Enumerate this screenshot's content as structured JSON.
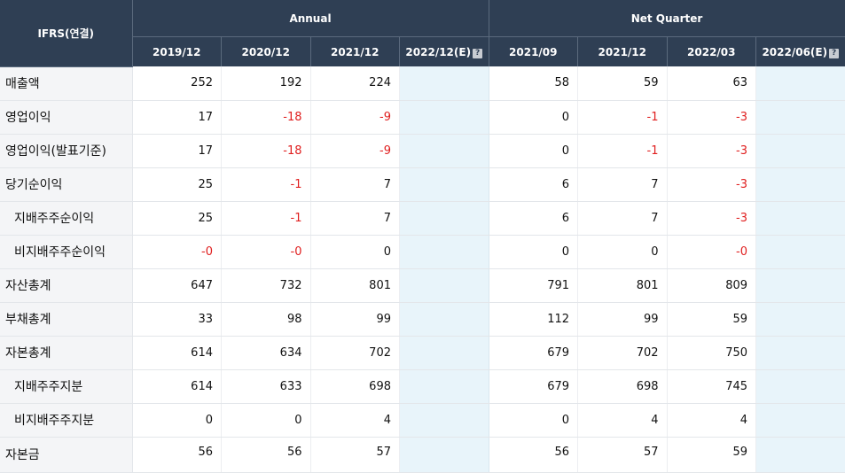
{
  "header": {
    "corner": "IFRS(연결)",
    "groups": [
      "Annual",
      "Net Quarter"
    ],
    "periods": [
      "2019/12",
      "2020/12",
      "2021/12",
      "2022/12(E)",
      "2021/09",
      "2021/12",
      "2022/03",
      "2022/06(E)"
    ],
    "help_icon": "question-mark-icon",
    "help_glyph": "?"
  },
  "colors": {
    "header_bg": "#2f3f54",
    "negative": "#e02020",
    "estimate_bg": "#e8f4fa"
  },
  "rows": [
    {
      "label": "매출액",
      "values": [
        "252",
        "192",
        "224",
        "",
        "58",
        "59",
        "63",
        ""
      ]
    },
    {
      "label": "영업이익",
      "values": [
        "17",
        "-18",
        "-9",
        "",
        "0",
        "-1",
        "-3",
        ""
      ]
    },
    {
      "label": "영업이익(발표기준)",
      "values": [
        "17",
        "-18",
        "-9",
        "",
        "0",
        "-1",
        "-3",
        ""
      ]
    },
    {
      "label": "당기순이익",
      "values": [
        "25",
        "-1",
        "7",
        "",
        "6",
        "7",
        "-3",
        ""
      ]
    },
    {
      "label": "지배주주순이익",
      "values": [
        "25",
        "-1",
        "7",
        "",
        "6",
        "7",
        "-3",
        ""
      ]
    },
    {
      "label": "비지배주주순이익",
      "values": [
        "-0",
        "-0",
        "0",
        "",
        "0",
        "0",
        "-0",
        ""
      ]
    },
    {
      "label": "자산총계",
      "values": [
        "647",
        "732",
        "801",
        "",
        "791",
        "801",
        "809",
        ""
      ]
    },
    {
      "label": "부채총계",
      "values": [
        "33",
        "98",
        "99",
        "",
        "112",
        "99",
        "59",
        ""
      ]
    },
    {
      "label": "자본총계",
      "values": [
        "614",
        "634",
        "702",
        "",
        "679",
        "702",
        "750",
        ""
      ]
    },
    {
      "label": "지배주주지분",
      "values": [
        "614",
        "633",
        "698",
        "",
        "679",
        "698",
        "745",
        ""
      ]
    },
    {
      "label": "비지배주주지분",
      "values": [
        "0",
        "0",
        "4",
        "",
        "0",
        "4",
        "4",
        ""
      ]
    },
    {
      "label": "자본금",
      "values": [
        "56",
        "56",
        "57",
        "",
        "56",
        "57",
        "59",
        ""
      ]
    }
  ]
}
